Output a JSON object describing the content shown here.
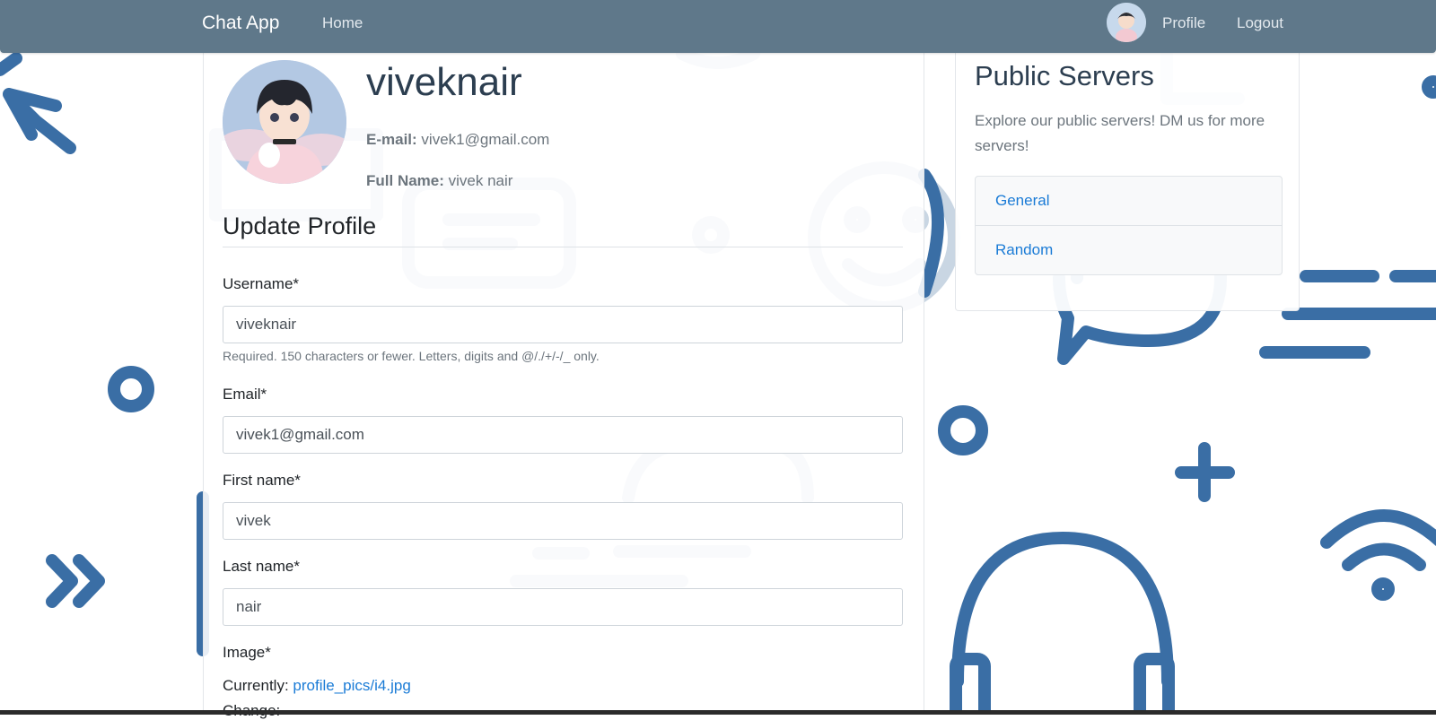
{
  "navbar": {
    "brand": "Chat App",
    "home_label": "Home",
    "profile_label": "Profile",
    "logout_label": "Logout",
    "avatar_icon": "user-avatar-icon"
  },
  "profile": {
    "username": "viveknair",
    "email_label": "E-mail:",
    "email_value": "vivek1@gmail.com",
    "fullname_label": "Full Name:",
    "fullname_value": "vivek nair"
  },
  "form": {
    "section_title": "Update Profile",
    "username_label": "Username*",
    "username_value": "viveknair",
    "username_help": "Required. 150 characters or fewer. Letters, digits and @/./+/-/_ only.",
    "email_label": "Email*",
    "email_value": "vivek1@gmail.com",
    "first_name_label": "First name*",
    "first_name_value": "vivek",
    "last_name_label": "Last name*",
    "last_name_value": "nair",
    "image_label": "Image*",
    "currently_label": "Currently:",
    "current_image": "profile_pics/i4.jpg",
    "change_label": "Change:"
  },
  "servers": {
    "title": "Public Servers",
    "description": "Explore our public servers! DM us for more servers!",
    "items": [
      {
        "label": "General"
      },
      {
        "label": "Random"
      }
    ]
  },
  "colors": {
    "navbar_bg": "#5f788a",
    "link": "#1a7bd6",
    "decor": "#3a6ea5"
  }
}
